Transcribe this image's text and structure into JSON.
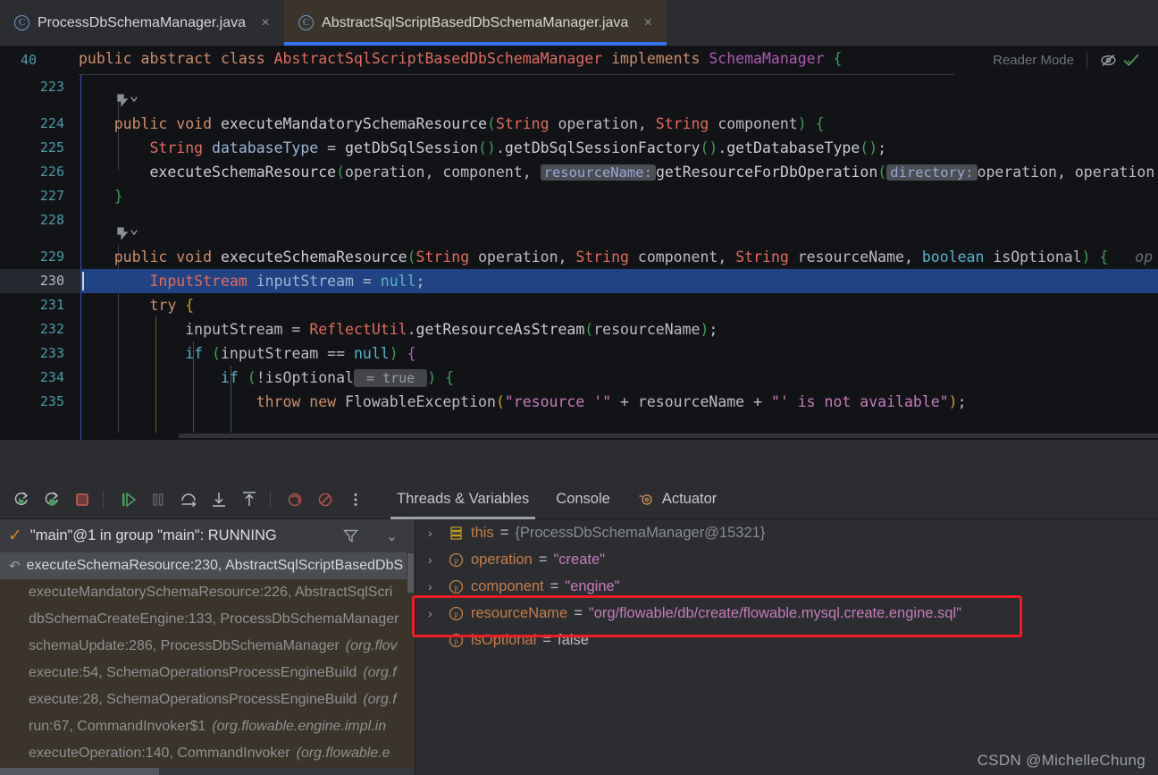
{
  "window": {
    "tabs": [
      {
        "label": "ProcessDbSchemaManager.java",
        "icon": "java-class-icon",
        "active": false,
        "close": "×"
      },
      {
        "label": "AbstractSqlScriptBasedDbSchemaManager.java",
        "icon": "java-class-icon",
        "active": true,
        "close": "×"
      }
    ]
  },
  "sticky": {
    "line_number": "40",
    "tokens": [
      {
        "t": "public",
        "c": "kw"
      },
      {
        "t": " ",
        "c": "plain"
      },
      {
        "t": "abstract",
        "c": "kw"
      },
      {
        "t": " ",
        "c": "plain"
      },
      {
        "t": "class",
        "c": "kw"
      },
      {
        "t": " ",
        "c": "plain"
      },
      {
        "t": "AbstractSqlScriptBasedDbSchemaManager",
        "c": "cls"
      },
      {
        "t": " ",
        "c": "plain"
      },
      {
        "t": "implements",
        "c": "kw"
      },
      {
        "t": " ",
        "c": "plain"
      },
      {
        "t": "SchemaManager",
        "c": "bra2"
      },
      {
        "t": " ",
        "c": "plain"
      },
      {
        "t": "{",
        "c": "par"
      }
    ]
  },
  "reader_bar": {
    "label": "Reader Mode",
    "icons": [
      "hidden-eye-icon",
      "inspections-ok-icon"
    ]
  },
  "editor": {
    "lines": [
      {
        "num": "223",
        "indent_guides": [],
        "tokens": []
      },
      {
        "num": "224",
        "gutter": "run-gutter-icon",
        "tokens": [
          {
            "t": "    ",
            "c": "plain"
          },
          {
            "t": "public",
            "c": "kw"
          },
          {
            "t": " ",
            "c": "plain"
          },
          {
            "t": "void",
            "c": "kw"
          },
          {
            "t": " ",
            "c": "plain"
          },
          {
            "t": "executeMandatorySchemaResource",
            "c": "fn"
          },
          {
            "t": "(",
            "c": "par"
          },
          {
            "t": "String",
            "c": "type"
          },
          {
            "t": " ",
            "c": "plain"
          },
          {
            "t": "operation",
            "c": "plain"
          },
          {
            "t": ", ",
            "c": "plain"
          },
          {
            "t": "String",
            "c": "type"
          },
          {
            "t": " ",
            "c": "plain"
          },
          {
            "t": "component",
            "c": "plain"
          },
          {
            "t": ")",
            "c": "par"
          },
          {
            "t": " ",
            "c": "plain"
          },
          {
            "t": "{",
            "c": "par"
          }
        ]
      },
      {
        "num": "225",
        "tokens": [
          {
            "t": "        ",
            "c": "plain"
          },
          {
            "t": "String",
            "c": "type"
          },
          {
            "t": " ",
            "c": "plain"
          },
          {
            "t": "databaseType",
            "c": "var"
          },
          {
            "t": " = ",
            "c": "plain"
          },
          {
            "t": "getDbSqlSession",
            "c": "fn"
          },
          {
            "t": "()",
            "c": "par"
          },
          {
            "t": ".",
            "c": "plain"
          },
          {
            "t": "getDbSqlSessionFactory",
            "c": "fn"
          },
          {
            "t": "()",
            "c": "par"
          },
          {
            "t": ".",
            "c": "plain"
          },
          {
            "t": "getDatabaseType",
            "c": "fn"
          },
          {
            "t": "()",
            "c": "par"
          },
          {
            "t": ";",
            "c": "plain"
          }
        ]
      },
      {
        "num": "226",
        "tokens": [
          {
            "t": "        ",
            "c": "plain"
          },
          {
            "t": "executeSchemaResource",
            "c": "fn"
          },
          {
            "t": "(",
            "c": "par"
          },
          {
            "t": "operation",
            "c": "plain"
          },
          {
            "t": ", ",
            "c": "plain"
          },
          {
            "t": "component",
            "c": "plain"
          },
          {
            "t": ", ",
            "c": "plain"
          },
          {
            "t": "resourceName:",
            "c": "param-hint"
          },
          {
            "t": "getResourceForDbOperation",
            "c": "fn"
          },
          {
            "t": "(",
            "c": "par"
          },
          {
            "t": "directory:",
            "c": "param-hint"
          },
          {
            "t": "operation",
            "c": "plain"
          },
          {
            "t": ", ",
            "c": "plain"
          },
          {
            "t": "operation",
            "c": "plain"
          }
        ]
      },
      {
        "num": "227",
        "tokens": [
          {
            "t": "    ",
            "c": "plain"
          },
          {
            "t": "}",
            "c": "par"
          }
        ]
      },
      {
        "num": "228",
        "tokens": []
      },
      {
        "num": "229",
        "gutter": "run-gutter-icon",
        "tokens": [
          {
            "t": "    ",
            "c": "plain"
          },
          {
            "t": "public",
            "c": "kw"
          },
          {
            "t": " ",
            "c": "plain"
          },
          {
            "t": "void",
            "c": "kw"
          },
          {
            "t": " ",
            "c": "plain"
          },
          {
            "t": "executeSchemaResource",
            "c": "fn"
          },
          {
            "t": "(",
            "c": "par"
          },
          {
            "t": "String",
            "c": "type"
          },
          {
            "t": " ",
            "c": "plain"
          },
          {
            "t": "operation",
            "c": "plain"
          },
          {
            "t": ", ",
            "c": "plain"
          },
          {
            "t": "String",
            "c": "type"
          },
          {
            "t": " ",
            "c": "plain"
          },
          {
            "t": "component",
            "c": "plain"
          },
          {
            "t": ", ",
            "c": "plain"
          },
          {
            "t": "String",
            "c": "type"
          },
          {
            "t": " ",
            "c": "plain"
          },
          {
            "t": "resourceName",
            "c": "plain"
          },
          {
            "t": ", ",
            "c": "plain"
          },
          {
            "t": "boolean",
            "c": "kw2"
          },
          {
            "t": " ",
            "c": "plain"
          },
          {
            "t": "isOptional",
            "c": "plain"
          },
          {
            "t": ")",
            "c": "par"
          },
          {
            "t": " ",
            "c": "plain"
          },
          {
            "t": "{",
            "c": "par"
          },
          {
            "t": "   ",
            "c": "plain"
          },
          {
            "t": "op",
            "c": "inline-italic"
          }
        ]
      },
      {
        "num": "230",
        "current": true,
        "tokens": [
          {
            "t": "        ",
            "c": "plain"
          },
          {
            "t": "InputStream",
            "c": "type"
          },
          {
            "t": " ",
            "c": "plain"
          },
          {
            "t": "inputStream",
            "c": "var"
          },
          {
            "t": " = ",
            "c": "plain"
          },
          {
            "t": "null",
            "c": "nullk"
          },
          {
            "t": ";",
            "c": "plain"
          }
        ]
      },
      {
        "num": "231",
        "tokens": [
          {
            "t": "        ",
            "c": "plain"
          },
          {
            "t": "try",
            "c": "kw"
          },
          {
            "t": " ",
            "c": "plain"
          },
          {
            "t": "{",
            "c": "bra"
          }
        ]
      },
      {
        "num": "232",
        "tokens": [
          {
            "t": "            ",
            "c": "plain"
          },
          {
            "t": "inputStream",
            "c": "plain"
          },
          {
            "t": " = ",
            "c": "plain"
          },
          {
            "t": "ReflectUtil",
            "c": "type"
          },
          {
            "t": ".",
            "c": "plain"
          },
          {
            "t": "getResourceAsStream",
            "c": "fn"
          },
          {
            "t": "(",
            "c": "par"
          },
          {
            "t": "resourceName",
            "c": "plain"
          },
          {
            "t": ")",
            "c": "par"
          },
          {
            "t": ";",
            "c": "plain"
          }
        ]
      },
      {
        "num": "233",
        "tokens": [
          {
            "t": "            ",
            "c": "plain"
          },
          {
            "t": "if",
            "c": "kw2"
          },
          {
            "t": " ",
            "c": "plain"
          },
          {
            "t": "(",
            "c": "par"
          },
          {
            "t": "inputStream",
            "c": "plain"
          },
          {
            "t": " == ",
            "c": "plain"
          },
          {
            "t": "null",
            "c": "nullk"
          },
          {
            "t": ")",
            "c": "par"
          },
          {
            "t": " ",
            "c": "plain"
          },
          {
            "t": "{",
            "c": "bra2"
          }
        ]
      },
      {
        "num": "234",
        "tokens": [
          {
            "t": "                ",
            "c": "plain"
          },
          {
            "t": "if",
            "c": "kw2"
          },
          {
            "t": " ",
            "c": "plain"
          },
          {
            "t": "(",
            "c": "par"
          },
          {
            "t": "!isOptional",
            "c": "plain"
          },
          {
            "t": " = true ",
            "c": "hint"
          },
          {
            "t": ")",
            "c": "par"
          },
          {
            "t": " ",
            "c": "plain"
          },
          {
            "t": "{",
            "c": "par"
          }
        ]
      },
      {
        "num": "235",
        "tokens": [
          {
            "t": "                    ",
            "c": "plain"
          },
          {
            "t": "throw",
            "c": "kw"
          },
          {
            "t": " ",
            "c": "plain"
          },
          {
            "t": "new",
            "c": "kw"
          },
          {
            "t": " ",
            "c": "plain"
          },
          {
            "t": "FlowableException",
            "c": "plain"
          },
          {
            "t": "(",
            "c": "bra"
          },
          {
            "t": "\"resource '\"",
            "c": "str"
          },
          {
            "t": " + ",
            "c": "plain"
          },
          {
            "t": "resourceName",
            "c": "plain"
          },
          {
            "t": " + ",
            "c": "plain"
          },
          {
            "t": "\"' is not available\"",
            "c": "str"
          },
          {
            "t": ")",
            "c": "bra"
          },
          {
            "t": ";",
            "c": "plain"
          }
        ]
      }
    ]
  },
  "debug_toolbar": {
    "buttons": [
      {
        "name": "rerun-button",
        "title": "Rerun"
      },
      {
        "name": "rerun-debug-button",
        "title": "Rerun with Debug"
      },
      {
        "name": "stop-button",
        "title": "Stop"
      },
      {
        "name": "resume-program-button",
        "title": "Resume Program"
      },
      {
        "name": "pause-program-button",
        "title": "Pause Program"
      },
      {
        "name": "step-over-button",
        "title": "Step Over"
      },
      {
        "name": "step-into-button",
        "title": "Step Into"
      },
      {
        "name": "step-out-button",
        "title": "Step Out"
      },
      {
        "name": "view-breakpoints-button",
        "title": "View Breakpoints"
      },
      {
        "name": "mute-breakpoints-button",
        "title": "Mute Breakpoints"
      },
      {
        "name": "more-options-button",
        "title": "More"
      }
    ],
    "tabs": [
      {
        "label": "Threads & Variables",
        "active": true,
        "icon": null
      },
      {
        "label": "Console",
        "active": false,
        "icon": null
      },
      {
        "label": "Actuator",
        "active": false,
        "icon": "actuator-icon"
      }
    ]
  },
  "threads": {
    "status_label": "\"main\"@1 in group \"main\": RUNNING",
    "filter_icon": "filter-icon",
    "chevron_icon": "chevron-down-icon",
    "frames": [
      {
        "method": "executeSchemaResource:230, AbstractSqlScriptBasedDbS",
        "pkg": "",
        "selected": true
      },
      {
        "method": "executeMandatorySchemaResource:226, AbstractSqlScri",
        "pkg": "",
        "selected": false
      },
      {
        "method": "dbSchemaCreateEngine:133, ProcessDbSchemaManager",
        "pkg": "",
        "selected": false
      },
      {
        "method": "schemaUpdate:286, ProcessDbSchemaManager",
        "pkg": "(org.flov",
        "selected": false
      },
      {
        "method": "execute:54, SchemaOperationsProcessEngineBuild",
        "pkg": "(org.f",
        "selected": false
      },
      {
        "method": "execute:28, SchemaOperationsProcessEngineBuild",
        "pkg": "(org.f",
        "selected": false
      },
      {
        "method": "run:67, CommandInvoker$1",
        "pkg": "(org.flowable.engine.impl.in",
        "selected": false
      },
      {
        "method": "executeOperation:140, CommandInvoker",
        "pkg": "(org.flowable.e",
        "selected": false
      }
    ]
  },
  "variables": [
    {
      "arrow": "›",
      "icon": "object-value-icon",
      "name": "this",
      "eq": "=",
      "value": "{ProcessDbSchemaManager@15321}",
      "kind": "ref"
    },
    {
      "arrow": "›",
      "icon": "parameter-icon",
      "name": "operation",
      "eq": "=",
      "value": "\"create\"",
      "kind": "str"
    },
    {
      "arrow": "›",
      "icon": "parameter-icon",
      "name": "component",
      "eq": "=",
      "value": "\"engine\"",
      "kind": "str"
    },
    {
      "arrow": "›",
      "icon": "parameter-icon",
      "name": "resourceName",
      "eq": "=",
      "value": "\"org/flowable/db/create/flowable.mysql.create.engine.sql\"",
      "kind": "str",
      "highlighted": true
    },
    {
      "arrow": "",
      "icon": "parameter-icon",
      "name": "isOptional",
      "eq": "=",
      "value": "false",
      "kind": "bool"
    }
  ],
  "watermark": "CSDN @MichelleChung",
  "colors": {
    "accent_blue": "#3574f0",
    "tab_active_bg": "#3b342a",
    "editor_bg": "#121317",
    "panel_bg": "#2b2d30",
    "current_line": "#214283",
    "highlight_red": "#ee1c24",
    "string": "#c77dbb",
    "keyword": "#cf8e6d",
    "type": "#e06c5e"
  }
}
